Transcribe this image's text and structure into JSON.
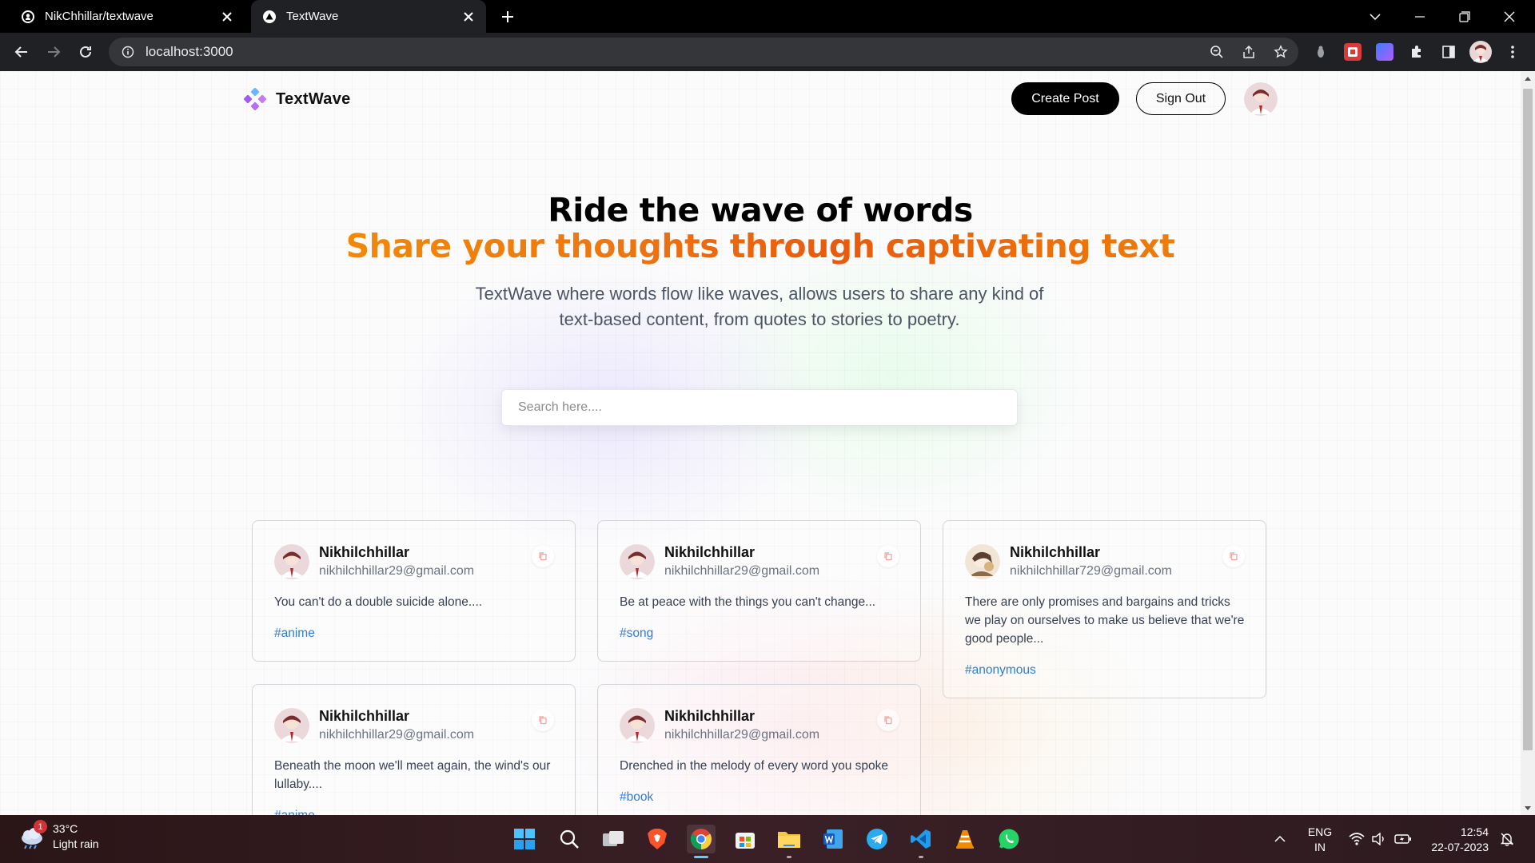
{
  "browser": {
    "tabs": [
      {
        "title": "NikChhillar/textwave",
        "active": false
      },
      {
        "title": "TextWave",
        "active": true
      }
    ],
    "url": "localhost:3000"
  },
  "nav": {
    "logo_text": "TextWave",
    "create_label": "Create Post",
    "signout_label": "Sign Out"
  },
  "hero": {
    "title": "Ride the wave of words",
    "subtitle": "Share your thoughts through captivating text",
    "description": "TextWave where words flow like waves, allows users to share any kind of text-based content, from quotes to stories to poetry."
  },
  "search": {
    "placeholder": "Search here...."
  },
  "posts": [
    {
      "name": "Nikhilchhillar",
      "email": "nikhilchhillar29@gmail.com",
      "text": "You can't do a double suicide alone....",
      "tag": "#anime"
    },
    {
      "name": "Nikhilchhillar",
      "email": "nikhilchhillar29@gmail.com",
      "text": "Be at peace with the things you can't change...",
      "tag": "#song"
    },
    {
      "name": "Nikhilchhillar",
      "email": "nikhilchhillar729@gmail.com",
      "text": "There are only promises and bargains and tricks we play on ourselves to make us believe that we're good people...",
      "tag": "#anonymous"
    },
    {
      "name": "Nikhilchhillar",
      "email": "nikhilchhillar29@gmail.com",
      "text": "Beneath the moon we'll meet again, the wind's our lullaby....",
      "tag": "#anime"
    },
    {
      "name": "Nikhilchhillar",
      "email": "nikhilchhillar29@gmail.com",
      "text": "Drenched in the melody of every word you spoke",
      "tag": "#book"
    }
  ],
  "taskbar": {
    "weather_temp": "33°C",
    "weather_desc": "Light rain",
    "weather_badge": "1",
    "apps": [
      "windows-start",
      "search",
      "task-view",
      "brave",
      "chrome",
      "microsoft-store",
      "file-explorer",
      "word",
      "telegram",
      "vscode",
      "vlc",
      "whatsapp"
    ],
    "lang_line1": "ENG",
    "lang_line2": "IN",
    "time": "12:54",
    "date": "22-07-2023"
  },
  "colors": {
    "accent_orange": "#ee7710",
    "tag_blue": "#2f7cd6",
    "button_black": "#000000"
  }
}
